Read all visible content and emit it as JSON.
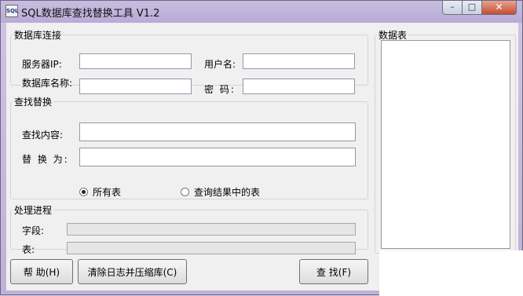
{
  "window": {
    "title": "SQL数据库查找替换工具 V1.2",
    "icon_label": "SQL",
    "min_glyph": "–",
    "max_glyph": "□",
    "close_glyph": "✕"
  },
  "db_connection": {
    "legend": "数据库连接",
    "server_label": "服务器IP:",
    "server_value": "",
    "user_label": "用户名:",
    "user_value": "",
    "dbname_label": "数据库名称:",
    "dbname_value": "",
    "password_label": "密 码:",
    "password_value": ""
  },
  "find_replace": {
    "legend": "查找替换",
    "find_label": "查找内容:",
    "find_value": "",
    "replace_label": "替 换 为:",
    "replace_value": "",
    "radio_all_label": "所有表",
    "radio_all_checked": true,
    "radio_result_label": "查询结果中的表",
    "radio_result_checked": false
  },
  "progress": {
    "legend": "处理进程",
    "field_label": "字段:",
    "field_value": 0,
    "table_label": "表:",
    "table_value": 0
  },
  "tables": {
    "legend": "数据表",
    "items": []
  },
  "buttons": {
    "help": "帮 助(H)",
    "clear_log": "清除日志并压缩库(C)",
    "find": "查 找(F)"
  }
}
